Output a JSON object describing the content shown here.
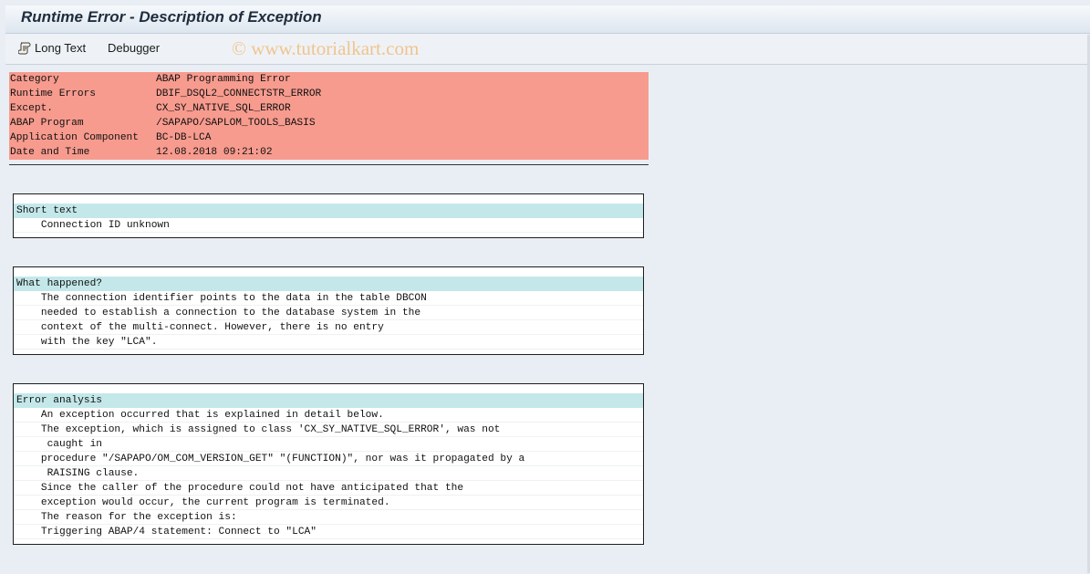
{
  "window": {
    "title": "Runtime Error - Description of Exception"
  },
  "toolbar": {
    "long_text_label": "Long Text",
    "debugger_label": "Debugger",
    "watermark": "© www.tutorialkart.com"
  },
  "header_rows": [
    {
      "key": "Category",
      "value": "ABAP Programming Error"
    },
    {
      "key": "Runtime Errors",
      "value": "DBIF_DSQL2_CONNECTSTR_ERROR"
    },
    {
      "key": "Except.",
      "value": "CX_SY_NATIVE_SQL_ERROR"
    },
    {
      "key": "ABAP Program",
      "value": "/SAPAPO/SAPLOM_TOOLS_BASIS"
    },
    {
      "key": "Application Component",
      "value": "BC-DB-LCA"
    },
    {
      "key": "Date and Time",
      "value": "12.08.2018 09:21:02"
    }
  ],
  "short_text": {
    "heading": "Short text",
    "lines": [
      "    Connection ID unknown"
    ]
  },
  "what_happened": {
    "heading": "What happened?",
    "lines": [
      "    The connection identifier points to the data in the table DBCON",
      "    needed to establish a connection to the database system in the",
      "    context of the multi-connect. However, there is no entry",
      "    with the key \"LCA\"."
    ]
  },
  "error_analysis": {
    "heading": "Error analysis",
    "lines": [
      "    An exception occurred that is explained in detail below.",
      "    The exception, which is assigned to class 'CX_SY_NATIVE_SQL_ERROR', was not",
      "     caught in",
      "    procedure \"/SAPAPO/OM_COM_VERSION_GET\" \"(FUNCTION)\", nor was it propagated by a",
      "     RAISING clause.",
      "    Since the caller of the procedure could not have anticipated that the",
      "    exception would occur, the current program is terminated.",
      "    The reason for the exception is:",
      "    Triggering ABAP/4 statement: Connect to \"LCA\""
    ]
  },
  "colors": {
    "header_row_bg": "#f79b8e",
    "section_head_bg": "#c4e8ea",
    "watermark": "#f0c48f"
  },
  "icons": {
    "long_text": "scroll-icon"
  }
}
